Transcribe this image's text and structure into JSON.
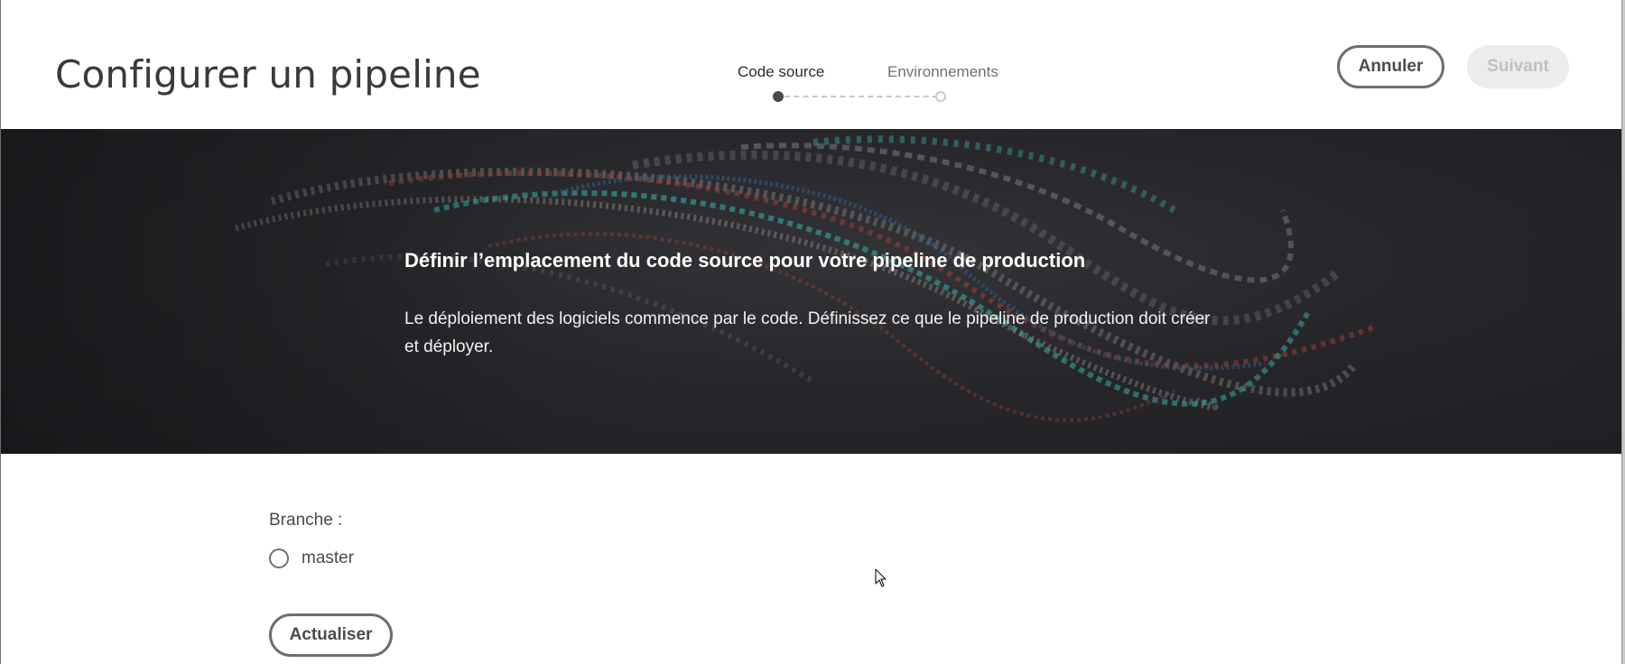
{
  "header": {
    "title": "Configurer un pipeline",
    "steps": [
      {
        "label": "Code source",
        "state": "active"
      },
      {
        "label": "Environnements",
        "state": "pending"
      }
    ],
    "cancel_label": "Annuler",
    "next_label": "Suivant"
  },
  "hero": {
    "title": "Définir l’emplacement du code source pour votre pipeline de production",
    "description": "Le déploiement des logiciels commence par le code. Définissez ce que le pipeline de production doit créer et déployer."
  },
  "form": {
    "branch_label": "Branche :",
    "branch_options": [
      {
        "label": "master",
        "selected": false
      }
    ],
    "refresh_label": "Actualiser"
  },
  "colors": {
    "hero_background": "#2b2b2f",
    "accent_teal": "#3ec6c1",
    "accent_red": "#c0392b",
    "accent_blue": "#3a6ea5",
    "disabled_button": "#ececec"
  }
}
